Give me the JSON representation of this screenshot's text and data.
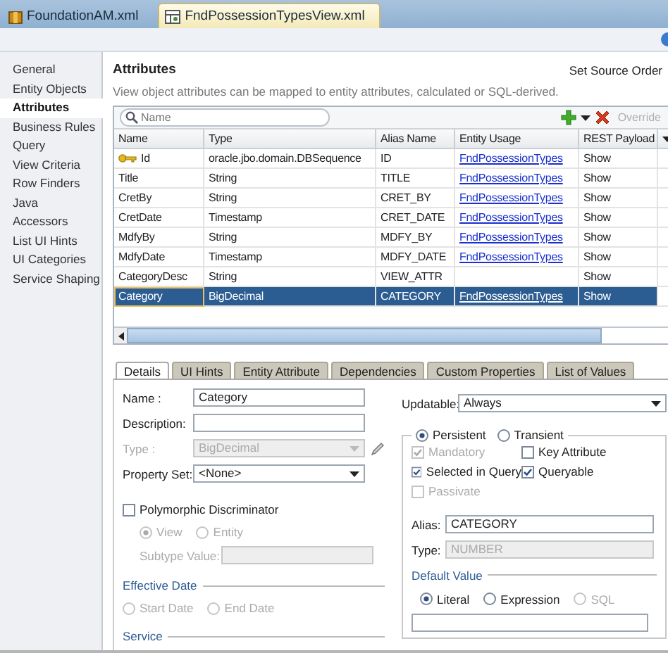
{
  "editor_tabs": [
    {
      "label": "FoundationAM.xml",
      "selected": false
    },
    {
      "label": "FndPossessionTypesView.xml",
      "selected": true
    }
  ],
  "nav": {
    "items": [
      {
        "label": "General",
        "selected": false
      },
      {
        "label": "Entity Objects",
        "selected": false
      },
      {
        "label": "Attributes",
        "selected": true
      },
      {
        "label": "Business Rules",
        "selected": false
      },
      {
        "label": "Query",
        "selected": false
      },
      {
        "label": "View Criteria",
        "selected": false
      },
      {
        "label": "Row Finders",
        "selected": false
      },
      {
        "label": "Java",
        "selected": false
      },
      {
        "label": "Accessors",
        "selected": false
      },
      {
        "label": "List UI Hints",
        "selected": false
      },
      {
        "label": "UI Categories",
        "selected": false
      },
      {
        "label": "Service Shaping",
        "selected": false
      }
    ]
  },
  "section": {
    "title": "Attributes",
    "action": "Set Source Order",
    "description": "View object attributes can be mapped to entity attributes, calculated or SQL-derived."
  },
  "table": {
    "search_placeholder": "Name",
    "override": {
      "label": "Override",
      "disabled": true
    },
    "columns": [
      "Name",
      "Type",
      "Alias Name",
      "Entity Usage",
      "REST Payload"
    ],
    "rows": [
      {
        "name": "Id",
        "type": "oracle.jbo.domain.DBSequence",
        "alias": "ID",
        "entity_usage": "FndPossessionTypes",
        "rest_payload": "Show",
        "key": true,
        "selected": false
      },
      {
        "name": "Title",
        "type": "String",
        "alias": "TITLE",
        "entity_usage": "FndPossessionTypes",
        "rest_payload": "Show",
        "key": false,
        "selected": false
      },
      {
        "name": "CretBy",
        "type": "String",
        "alias": "CRET_BY",
        "entity_usage": "FndPossessionTypes",
        "rest_payload": "Show",
        "key": false,
        "selected": false
      },
      {
        "name": "CretDate",
        "type": "Timestamp",
        "alias": "CRET_DATE",
        "entity_usage": "FndPossessionTypes",
        "rest_payload": "Show",
        "key": false,
        "selected": false
      },
      {
        "name": "MdfyBy",
        "type": "String",
        "alias": "MDFY_BY",
        "entity_usage": "FndPossessionTypes",
        "rest_payload": "Show",
        "key": false,
        "selected": false
      },
      {
        "name": "MdfyDate",
        "type": "Timestamp",
        "alias": "MDFY_DATE",
        "entity_usage": "FndPossessionTypes",
        "rest_payload": "Show",
        "key": false,
        "selected": false
      },
      {
        "name": "CategoryDesc",
        "type": "String",
        "alias": "VIEW_ATTR",
        "rest_payload": "Show",
        "key": false,
        "selected": false
      },
      {
        "name": "Category",
        "type": "BigDecimal",
        "alias": "CATEGORY",
        "entity_usage": "FndPossessionTypes",
        "rest_payload": "Show",
        "key": false,
        "selected": true
      }
    ]
  },
  "detail_tabs": [
    {
      "label": "Details",
      "selected": true
    },
    {
      "label": "UI Hints",
      "selected": false
    },
    {
      "label": "Entity Attribute",
      "selected": false
    },
    {
      "label": "Dependencies",
      "selected": false
    },
    {
      "label": "Custom Properties",
      "selected": false
    },
    {
      "label": "List of Values",
      "selected": false
    }
  ],
  "details": {
    "fields": [
      {
        "label": "Name :",
        "value": "Category",
        "kind": "text",
        "disabled": false
      },
      {
        "label": "Description:",
        "kind": "text",
        "disabled": false
      },
      {
        "label": "Type :",
        "value": "BigDecimal",
        "kind": "select",
        "disabled": true
      },
      {
        "label": "Property Set:",
        "value": "<None>",
        "kind": "select",
        "disabled": false
      }
    ],
    "polymorphic": {
      "label": "Polymorphic Discriminator",
      "checked": false
    },
    "discriminator_options": [
      {
        "label": "View",
        "selected": true,
        "disabled": true
      },
      {
        "label": "Entity",
        "selected": false,
        "disabled": true
      }
    ],
    "subtype": {
      "label": "Subtype Value:",
      "disabled": true
    },
    "effective_date": {
      "title": "Effective Date",
      "options": [
        {
          "label": "Start Date",
          "selected": false,
          "disabled": true
        },
        {
          "label": "End Date",
          "selected": false,
          "disabled": true
        }
      ]
    },
    "service": {
      "title": "Service"
    },
    "updatable": {
      "label": "Updatable:",
      "value": "Always"
    },
    "persistence": [
      {
        "label": "Persistent",
        "selected": true,
        "disabled": false
      },
      {
        "label": "Transient",
        "selected": false,
        "disabled": false
      }
    ],
    "flags": [
      {
        "label": "Mandatory",
        "checked": true,
        "disabled": true
      },
      {
        "label": "Key Attribute",
        "checked": false,
        "disabled": false
      },
      {
        "label": "Selected in Query",
        "checked": true,
        "disabled": false
      },
      {
        "label": "Queryable",
        "checked": true,
        "disabled": false
      },
      {
        "label": "Passivate",
        "checked": false,
        "disabled": true
      }
    ],
    "alias": {
      "label": "Alias:",
      "value": "CATEGORY",
      "disabled": false
    },
    "sql_type": {
      "label": "Type:",
      "value": "NUMBER",
      "disabled": true
    },
    "default_value": {
      "title": "Default Value",
      "options": [
        {
          "label": "Literal",
          "selected": true,
          "disabled": false
        },
        {
          "label": "Expression",
          "selected": false,
          "disabled": false
        },
        {
          "label": "SQL",
          "selected": false,
          "disabled": true
        }
      ]
    }
  }
}
